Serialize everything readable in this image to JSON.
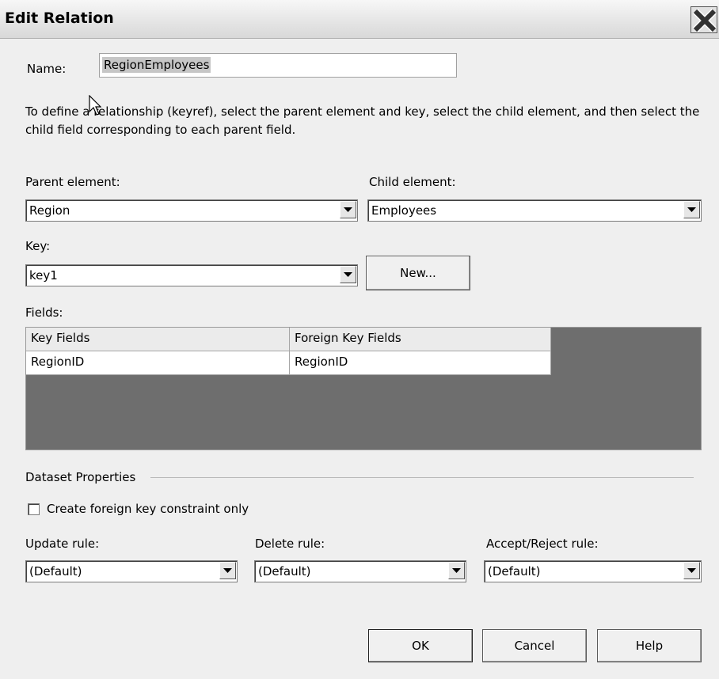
{
  "title": "Edit Relation",
  "name": {
    "label": "Name:",
    "value": "RegionEmployees"
  },
  "instructions": "To define a relationship (keyref), select the parent element and key, select the child element, and then select the child field corresponding to each parent field.",
  "parent_element": {
    "label": "Parent element:",
    "value": "Region"
  },
  "child_element": {
    "label": "Child element:",
    "value": "Employees"
  },
  "key": {
    "label": "Key:",
    "value": "key1",
    "new_button": "New..."
  },
  "fields": {
    "label": "Fields:",
    "headers": [
      "Key Fields",
      "Foreign Key Fields"
    ],
    "rows": [
      [
        "RegionID",
        "RegionID"
      ]
    ]
  },
  "dataset_properties": {
    "group_label": "Dataset Properties",
    "foreign_key_only": {
      "label": "Create foreign key constraint only",
      "checked": false
    },
    "update_rule": {
      "label": "Update rule:",
      "value": "(Default)"
    },
    "delete_rule": {
      "label": "Delete rule:",
      "value": "(Default)"
    },
    "accept_reject_rule": {
      "label": "Accept/Reject rule:",
      "value": "(Default)"
    }
  },
  "buttons": {
    "ok": "OK",
    "cancel": "Cancel",
    "help": "Help"
  }
}
